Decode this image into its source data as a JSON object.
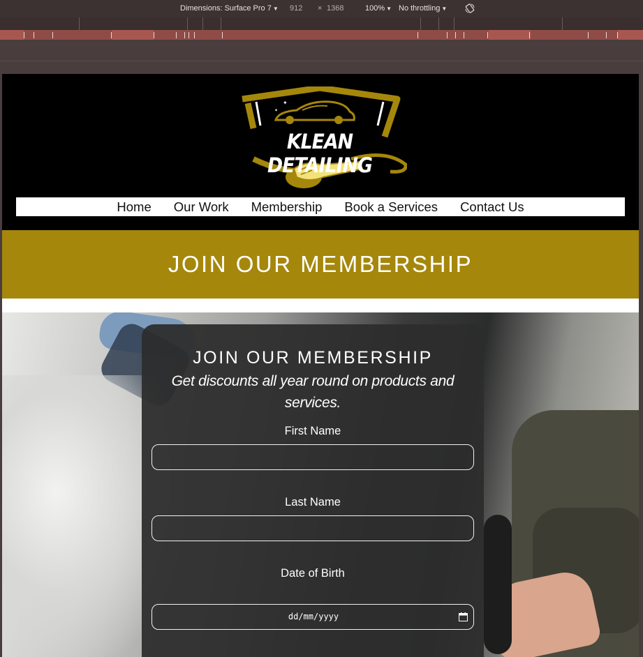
{
  "devtools": {
    "dimensions_label": "Dimensions: Surface Pro 7",
    "width": "912",
    "times": "×",
    "height": "1368",
    "zoom": "100%",
    "throttling": "No throttling",
    "rotate_icon": "rotate-icon"
  },
  "header": {
    "logo_text": "KLEAN DETAILING",
    "brand_color": "#a5870b",
    "nav": [
      "Home",
      "Our Work",
      "Membership",
      "Book a Services",
      "Contact Us"
    ]
  },
  "banner": {
    "title": "JOIN OUR MEMBERSHIP"
  },
  "form": {
    "title": "JOIN OUR MEMBERSHIP",
    "subtitle": "Get discounts all year round on products and services.",
    "first_name_label": "First Name",
    "first_name_value": "",
    "last_name_label": "Last Name",
    "last_name_value": "",
    "dob_label": "Date of Birth",
    "dob_placeholder": "dd/mm/yyyy",
    "calendar_icon": "calendar-icon"
  }
}
